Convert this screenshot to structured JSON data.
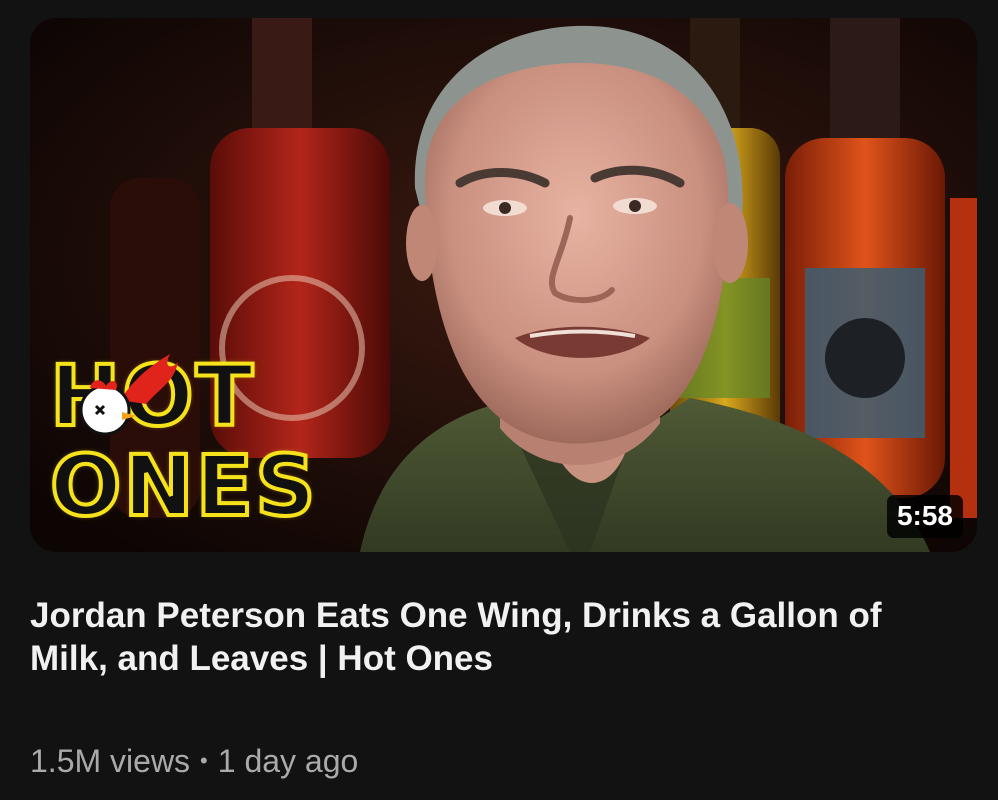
{
  "video": {
    "title": "Jordan Peterson Eats One Wing, Drinks a Gallon of Milk, and Leaves | Hot Ones",
    "duration": "5:58",
    "views": "1.5M views",
    "separator": "•",
    "age": "1 day ago"
  },
  "thumbnail": {
    "logo_line1": "HOT",
    "logo_line2": "ONES",
    "logo_color": "#f5e21b",
    "background_color": "#1a0c08"
  },
  "colors": {
    "page_background": "#121212",
    "title_text": "#f1f1f1",
    "meta_text": "#aaaaaa",
    "duration_badge": "#000000"
  }
}
